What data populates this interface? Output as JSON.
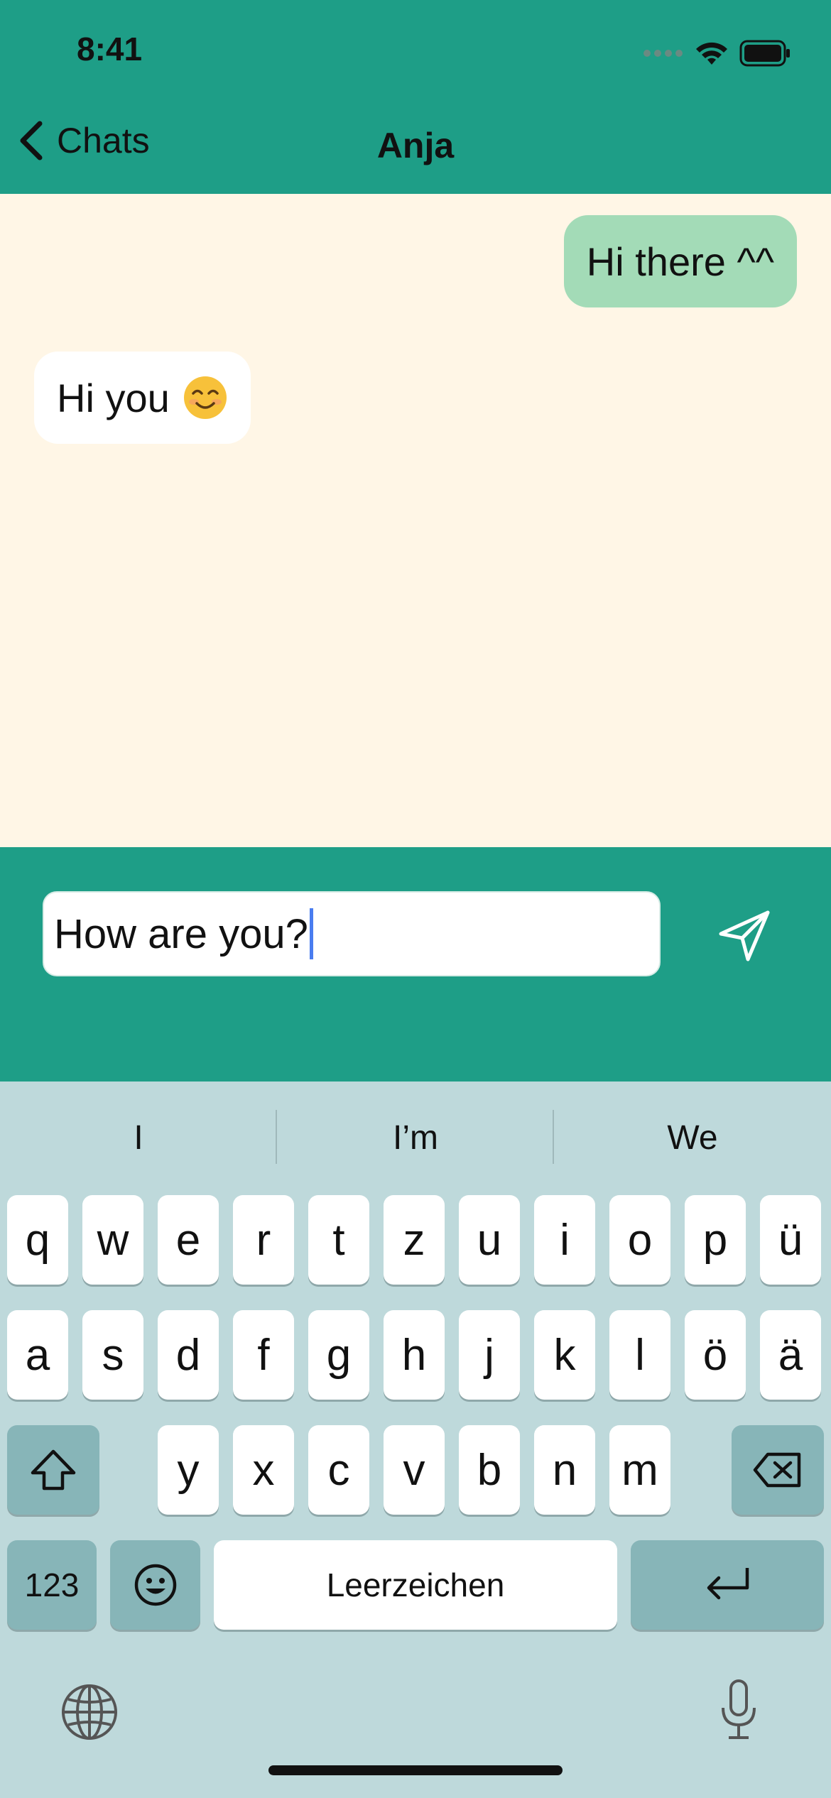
{
  "status_bar": {
    "time": "8:41"
  },
  "nav": {
    "back_label": "Chats",
    "title": "Anja"
  },
  "messages": {
    "outgoing": "Hi there ^^",
    "incoming": "Hi you"
  },
  "composer": {
    "text": "How are you?"
  },
  "suggestions": [
    "I",
    "I’m",
    "We"
  ],
  "keyboard": {
    "row1": [
      "q",
      "w",
      "e",
      "r",
      "t",
      "z",
      "u",
      "i",
      "o",
      "p",
      "ü"
    ],
    "row2": [
      "a",
      "s",
      "d",
      "f",
      "g",
      "h",
      "j",
      "k",
      "l",
      "ö",
      "ä"
    ],
    "row3": [
      "y",
      "x",
      "c",
      "v",
      "b",
      "n",
      "m"
    ],
    "numbers_label": "123",
    "space_label": "Leerzeichen"
  },
  "colors": {
    "header": "#1e9e87",
    "chat_background": "#fff6e6",
    "outgoing_bubble": "#a3dbb7",
    "keyboard_background": "#bed9db"
  },
  "icons": {
    "back": "chevron-left-icon",
    "send": "paper-plane-icon",
    "shift": "shift-arrow-icon",
    "delete": "backspace-icon",
    "emoji_key": "smiley-icon",
    "return": "return-arrow-icon",
    "globe": "globe-icon",
    "mic": "microphone-icon"
  }
}
